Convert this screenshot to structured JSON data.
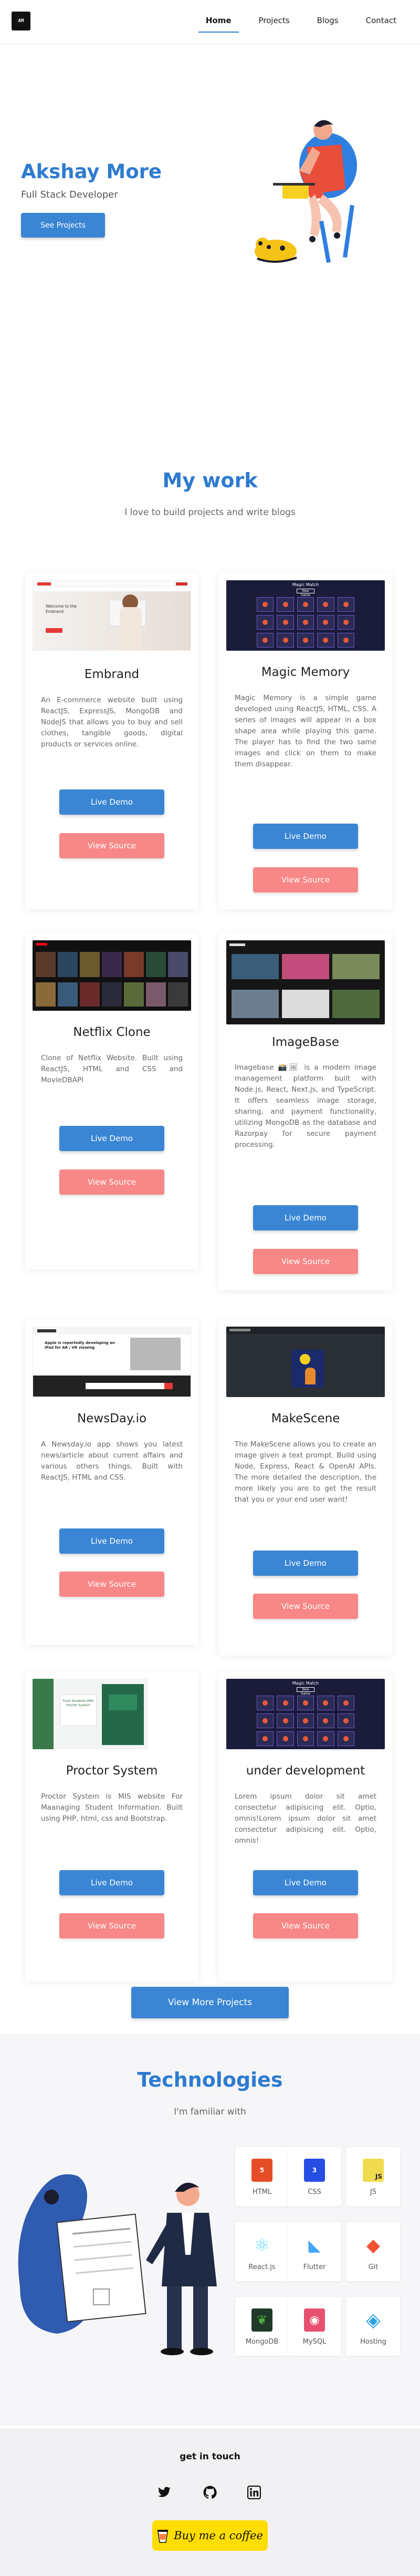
{
  "nav": {
    "logo_text": "AM",
    "links": [
      {
        "label": "Home",
        "active": true
      },
      {
        "label": "Projects",
        "active": false
      },
      {
        "label": "Blogs",
        "active": false
      },
      {
        "label": "Contact",
        "active": false
      }
    ]
  },
  "hero": {
    "name": "Akshay More",
    "role": "Full Stack Developer",
    "cta_label": "See Projects"
  },
  "work": {
    "title": "My work",
    "subtitle": "I love to build projects and write blogs",
    "live_label": "Live Demo",
    "source_label": "View Source",
    "projects": [
      {
        "title": "Embrand",
        "description": "An E-commerce website built using ReactJS, ExpressJS, MongoDB and NodeJS that allows you to buy and sell clothes, tangible goods, digital products or services online."
      },
      {
        "title": "Magic Memory",
        "description": "Magic Memory is a simple game developed using ReactJS, HTML, CSS. A series of images will appear in a box shape area while playing this game. The player has to find the two same images and click on them to make them disappear."
      },
      {
        "title": "Netflix Clone",
        "description": "Clone of Netflix Website. Built using ReactJS, HTML and CSS and MovieDBAPI"
      },
      {
        "title": "ImageBase",
        "description": "Imagebase 📸🖼 is a modern image management platform built with Node.js, React, Next.js, and TypeScript. It offers seamless image storage, sharing, and payment functionality, utilizing MongoDB as the database and Razorpay for secure payment processing."
      },
      {
        "title": "NewsDay.io",
        "description": "A Newsday.io app shows you latest news/article about current affairs and various others things. Built with ReactJS, HTML and CSS."
      },
      {
        "title": "MakeScene",
        "description": "The MakeScene allows you to create an image given a text prompt. Build using Node, Express, React & OpenAI APIs. The more detailed the description, the more likely you are to get the result that you or your end user want!"
      },
      {
        "title": "Proctor System",
        "description": "Proctor System is MIS website For Maanaging Student Information. Built using PHP, html, css and Bootstrap."
      },
      {
        "title": "under development",
        "description": "Lorem ipsum dolor sit amet consectetur adipisicing elit. Optio, omnis!Lorem ipsum dolor sit amet consectetur adipisicing elit. Optio, omnis!"
      }
    ],
    "more_label": "View More Projects",
    "thumbs": {
      "embrand_heading": "Welcome to the Embrand",
      "magic_heading": "Magic Match",
      "magic_button": "New Game",
      "news_headline": "Apple is reportedly developing an iPad for AR / VR viewing",
      "proctor_heading": "Track Students With",
      "proctor_heading_2": "Proctor System"
    }
  },
  "tech": {
    "title": "Technologies",
    "subtitle": "I'm familiar with",
    "items": [
      {
        "label": "HTML",
        "icon": "html5-icon",
        "badge": "5",
        "color": "#e44d26"
      },
      {
        "label": "CSS",
        "icon": "css3-icon",
        "badge": "3",
        "color": "#264de4"
      },
      {
        "label": "JS",
        "icon": "javascript-icon",
        "badge": "JS",
        "color": "#f0db4f"
      },
      {
        "label": "React.js",
        "icon": "react-icon",
        "badge": "⚛",
        "color": "#61dafb"
      },
      {
        "label": "Flutter",
        "icon": "flutter-icon",
        "badge": "◣",
        "color": "#42a5f5"
      },
      {
        "label": "Git",
        "icon": "git-icon",
        "badge": "◆",
        "color": "#f05133"
      },
      {
        "label": "MongoDB",
        "icon": "mongodb-icon",
        "badge": "❦",
        "color": "#4db33d"
      },
      {
        "label": "MySQL",
        "icon": "mysql-icon",
        "badge": "◉",
        "color": "#e8506f"
      },
      {
        "label": "Hosting",
        "icon": "hosting-icon",
        "badge": "◈",
        "color": "#2aa3e0"
      }
    ]
  },
  "footer": {
    "title": "get in touch",
    "socials": [
      {
        "name": "twitter-icon"
      },
      {
        "name": "github-icon"
      },
      {
        "name": "linkedin-icon"
      }
    ],
    "coffee_label": "Buy me a coffee"
  },
  "colors": {
    "accent": "#2e7bd0",
    "button_blue": "#3a86d4",
    "button_red": "#f88787",
    "coffee": "#ffdd00"
  }
}
